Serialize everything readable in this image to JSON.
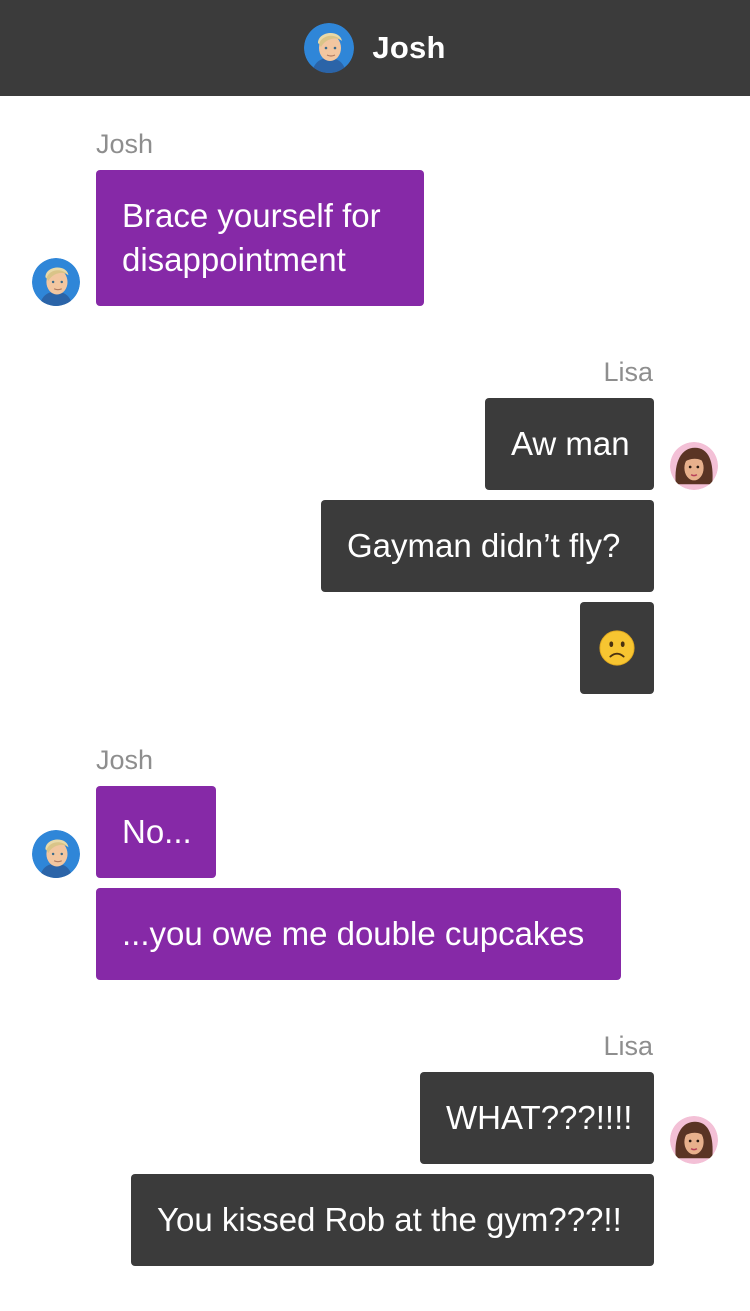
{
  "header": {
    "title": "Josh",
    "avatar_icon": "josh-avatar-icon"
  },
  "colors": {
    "header_bg": "#3b3b3b",
    "josh_bubble": "#8629a7",
    "lisa_bubble": "#3b3b3b",
    "sender_name": "#8e8e8e"
  },
  "messages": [
    {
      "sender": "Josh",
      "bubbles": [
        "Brace yourself for disappointment"
      ]
    },
    {
      "sender": "Lisa",
      "bubbles": [
        "Aw man",
        "Gayman didn’t fly?",
        "slightly-frowning-face-emoji"
      ]
    },
    {
      "sender": "Josh",
      "bubbles": [
        "No...",
        "...you owe me double cupcakes"
      ]
    },
    {
      "sender": "Lisa",
      "bubbles": [
        "WHAT???!!!!",
        "You kissed Rob at the gym???!!"
      ]
    }
  ]
}
